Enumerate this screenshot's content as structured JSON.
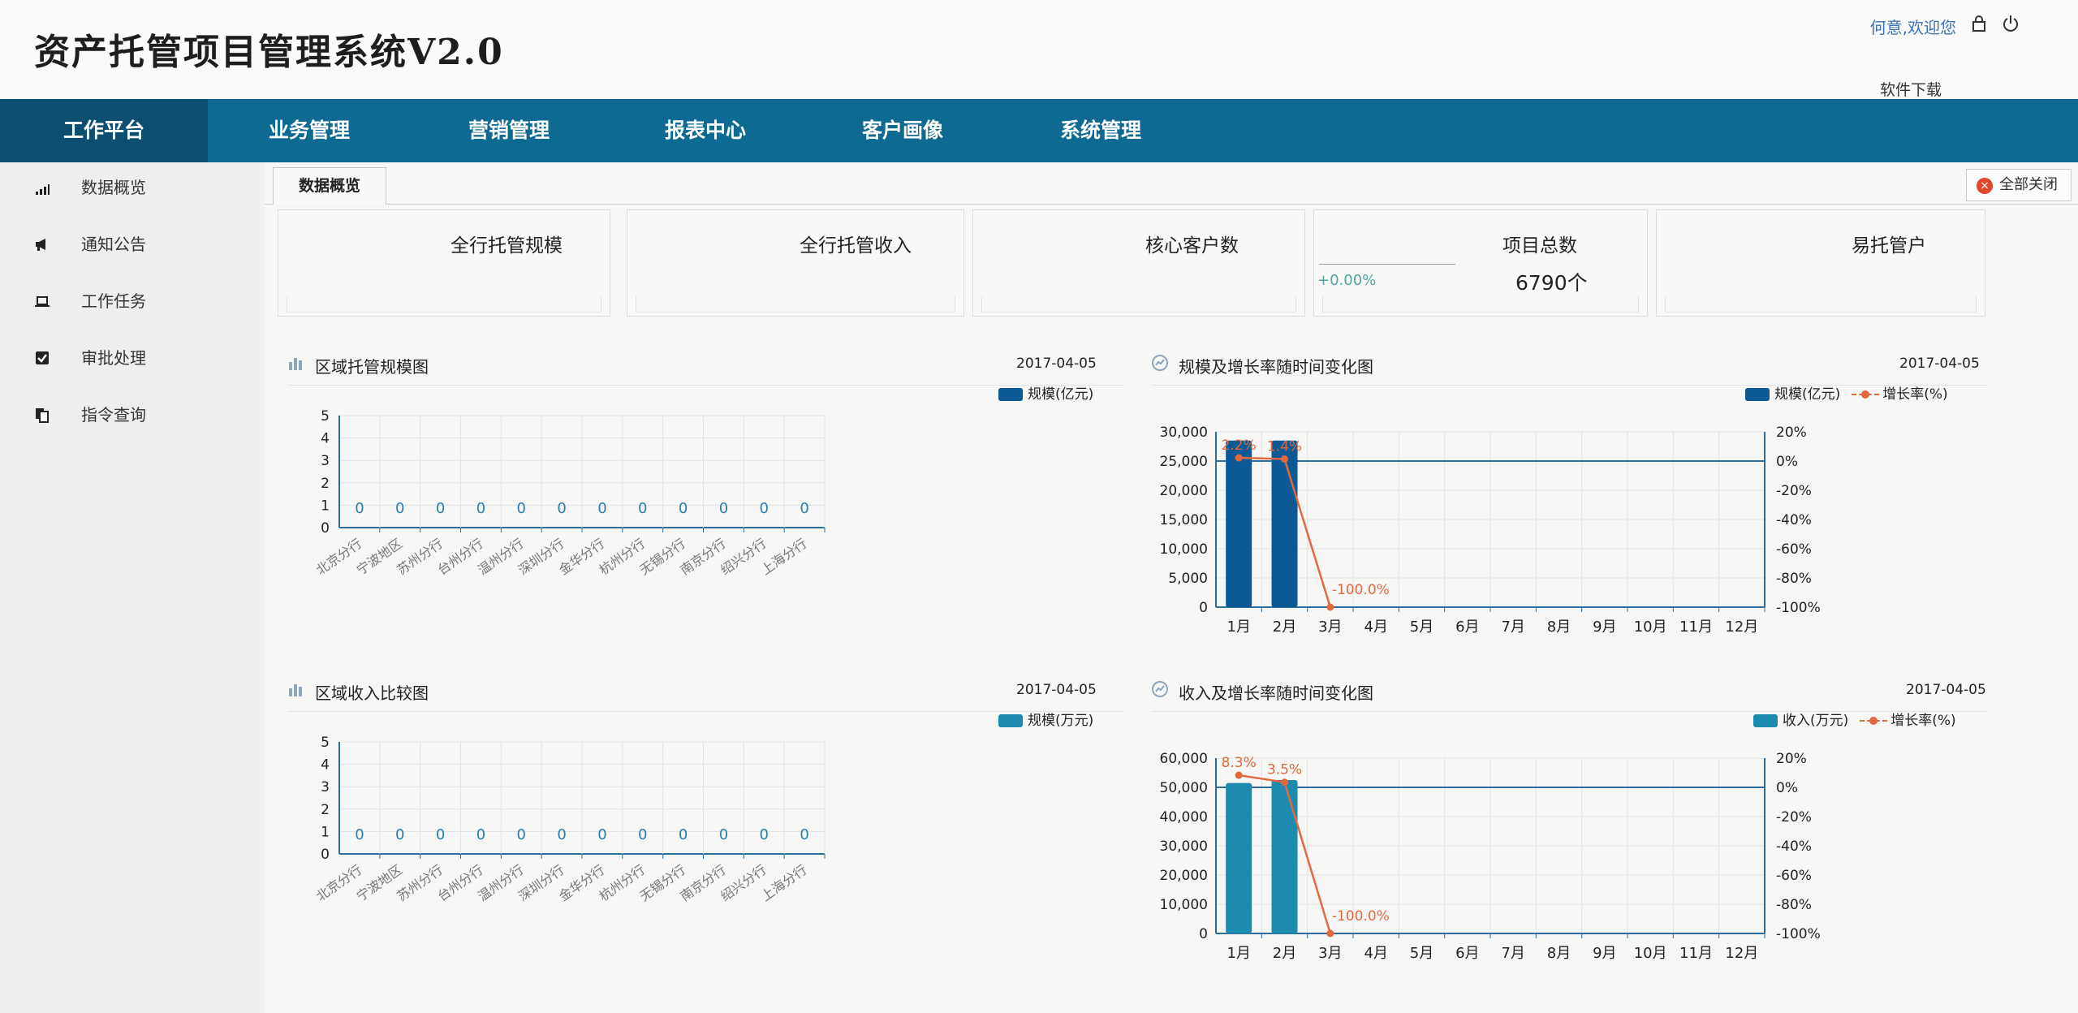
{
  "header": {
    "title": "资产托管项目管理系统V2.0",
    "welcome": "何意,欢迎您",
    "download": "软件下载",
    "icons": [
      "lock-icon",
      "power-icon"
    ]
  },
  "nav": {
    "items": [
      {
        "label": "工作平台",
        "active": true
      },
      {
        "label": "业务管理"
      },
      {
        "label": "营销管理"
      },
      {
        "label": "报表中心"
      },
      {
        "label": "客户画像"
      },
      {
        "label": "系统管理"
      }
    ]
  },
  "sidebar": {
    "items": [
      {
        "label": "数据概览",
        "icon": "signal-bars-icon"
      },
      {
        "label": "通知公告",
        "icon": "megaphone-icon"
      },
      {
        "label": "工作任务",
        "icon": "laptop-icon"
      },
      {
        "label": "审批处理",
        "icon": "checkbox-icon"
      },
      {
        "label": "指令查询",
        "icon": "documents-icon"
      }
    ]
  },
  "tabs": {
    "active": "数据概览",
    "close_all": "全部关闭"
  },
  "stats": [
    {
      "title": "全行托管规模"
    },
    {
      "title": "全行托管收入"
    },
    {
      "title": "核心客户数"
    },
    {
      "title": "项目总数",
      "change": "+0.00%",
      "value": "6790个"
    },
    {
      "title": "易托管户"
    }
  ],
  "colors": {
    "nav": "#0e6a92",
    "bar_scale": "#0b5a96",
    "bar_income": "#1d8ab0",
    "growth_line": "#e0693f"
  },
  "chart_data": [
    {
      "type": "bar",
      "title": "区域托管规模图",
      "date": "2017-04-05",
      "categories": [
        "北京分行",
        "宁波地区",
        "苏州分行",
        "台州分行",
        "温州分行",
        "深圳分行",
        "金华分行",
        "杭州分行",
        "无锡分行",
        "南京分行",
        "绍兴分行",
        "上海分行"
      ],
      "series": [
        {
          "name": "规模(亿元)",
          "values": [
            0,
            0,
            0,
            0,
            0,
            0,
            0,
            0,
            0,
            0,
            0,
            0
          ]
        }
      ],
      "ylim": [
        0,
        5
      ],
      "yticks": [
        "0",
        "1",
        "2",
        "3",
        "4",
        "5"
      ],
      "grid": true,
      "legend": "top-right"
    },
    {
      "type": "bar",
      "title": "规模及增长率随时间变化图",
      "date": "2017-04-05",
      "categories": [
        "1月",
        "2月",
        "3月",
        "4月",
        "5月",
        "6月",
        "7月",
        "8月",
        "9月",
        "10月",
        "11月",
        "12月"
      ],
      "series": [
        {
          "name": "规模(亿元)",
          "type": "bar",
          "values": [
            28500,
            28500,
            0,
            0,
            0,
            0,
            0,
            0,
            0,
            0,
            0,
            0
          ]
        },
        {
          "name": "增长率(%)",
          "type": "line",
          "axis": "right",
          "values": [
            2.2,
            1.4,
            -100.0
          ]
        }
      ],
      "labels": [
        "2.2%",
        "1.4%",
        "-100.0%"
      ],
      "ylim": [
        0,
        30000
      ],
      "yticks": [
        "0",
        "5,000",
        "10,000",
        "15,000",
        "20,000",
        "25,000",
        "30,000"
      ],
      "y2lim": [
        -100,
        20
      ],
      "y2ticks": [
        "-100%",
        "-80%",
        "-60%",
        "-40%",
        "-20%",
        "0%",
        "20%"
      ],
      "grid": true,
      "legend": "top-right"
    },
    {
      "type": "bar",
      "title": "区域收入比较图",
      "date": "2017-04-05",
      "categories": [
        "北京分行",
        "宁波地区",
        "苏州分行",
        "台州分行",
        "温州分行",
        "深圳分行",
        "金华分行",
        "杭州分行",
        "无锡分行",
        "南京分行",
        "绍兴分行",
        "上海分行"
      ],
      "series": [
        {
          "name": "规模(万元)",
          "values": [
            0,
            0,
            0,
            0,
            0,
            0,
            0,
            0,
            0,
            0,
            0,
            0
          ]
        }
      ],
      "ylim": [
        0,
        5
      ],
      "yticks": [
        "0",
        "1",
        "2",
        "3",
        "4",
        "5"
      ],
      "grid": true,
      "legend": "top-right"
    },
    {
      "type": "bar",
      "title": "收入及增长率随时间变化图",
      "date": "2017-04-05",
      "categories": [
        "1月",
        "2月",
        "3月",
        "4月",
        "5月",
        "6月",
        "7月",
        "8月",
        "9月",
        "10月",
        "11月",
        "12月"
      ],
      "series": [
        {
          "name": "收入(万元)",
          "type": "bar",
          "values": [
            51500,
            52500,
            0,
            0,
            0,
            0,
            0,
            0,
            0,
            0,
            0,
            0
          ]
        },
        {
          "name": "增长率(%)",
          "type": "line",
          "axis": "right",
          "values": [
            8.3,
            3.5,
            -100.0
          ]
        }
      ],
      "labels": [
        "8.3%",
        "3.5%",
        "-100.0%"
      ],
      "ylim": [
        0,
        60000
      ],
      "yticks": [
        "0",
        "10,000",
        "20,000",
        "30,000",
        "40,000",
        "50,000",
        "60,000"
      ],
      "y2lim": [
        -100,
        20
      ],
      "y2ticks": [
        "-100%",
        "-80%",
        "-60%",
        "-40%",
        "-20%",
        "0%",
        "20%"
      ],
      "grid": true,
      "legend": "top-right"
    }
  ]
}
